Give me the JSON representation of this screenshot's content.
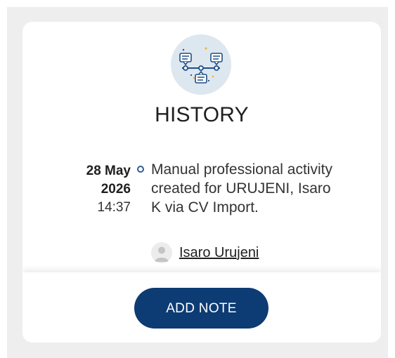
{
  "history": {
    "title": "HISTORY",
    "icon": "timeline-chat-icon",
    "entries": [
      {
        "date_line1": "28 May",
        "date_line2": "2026",
        "time": "14:37",
        "text": "Manual professional activity created for URUJENI, Isaro K via CV Import.",
        "user": "Isaro Urujeni"
      }
    ],
    "add_note_label": "ADD NOTE"
  },
  "colors": {
    "accent": "#0d3b73",
    "icon_bg": "#dde7ef",
    "timeline_dot": "#2f5e95"
  }
}
